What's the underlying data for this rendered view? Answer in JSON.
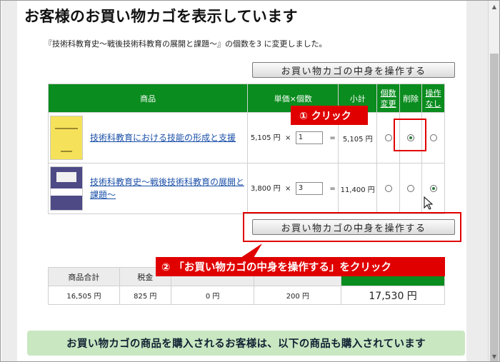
{
  "page": {
    "title": "お客様のお買い物カゴを表示しています",
    "notice": "『技術科教育史〜戦後技術科教育の展開と課題〜』の個数を3 に変更しました。",
    "operate_button": "お買い物カゴの中身を操作する"
  },
  "cart": {
    "headers": {
      "product": "商品",
      "unit_qty": "単価×個数",
      "subtotal": "小計",
      "change_qty": [
        "個数",
        "変更"
      ],
      "delete": "削除",
      "no_op": [
        "操作",
        "なし"
      ]
    },
    "times_symbol": "×",
    "equals_symbol": "=",
    "rows": [
      {
        "name": "技術科教育における技能の形成と支援",
        "unit_price": "5,105 円",
        "qty": "1",
        "subtotal": "5,105 円",
        "selected": "delete"
      },
      {
        "name": "技術科教育史〜戦後技術科教育の展開と課題〜",
        "unit_price": "3,800 円",
        "qty": "3",
        "subtotal": "11,400 円",
        "selected": "none"
      }
    ]
  },
  "summary": {
    "headers": [
      "商品合計",
      "税金",
      "",
      "",
      ""
    ],
    "values": [
      "16,505 円",
      "825 円",
      "0 円",
      "200 円",
      "17,530 円"
    ]
  },
  "annotations": {
    "step1": "① クリック",
    "step2": "② 「お買い物カゴの中身を操作する」をクリック"
  },
  "banner": "お買い物カゴの商品を購入されるお客様は、以下の商品も購入されています",
  "colors": {
    "header_green": "#0a8c1e",
    "callout_red": "#e00000",
    "banner_green": "#c9e7c1",
    "link_blue": "#1a4fa8"
  }
}
